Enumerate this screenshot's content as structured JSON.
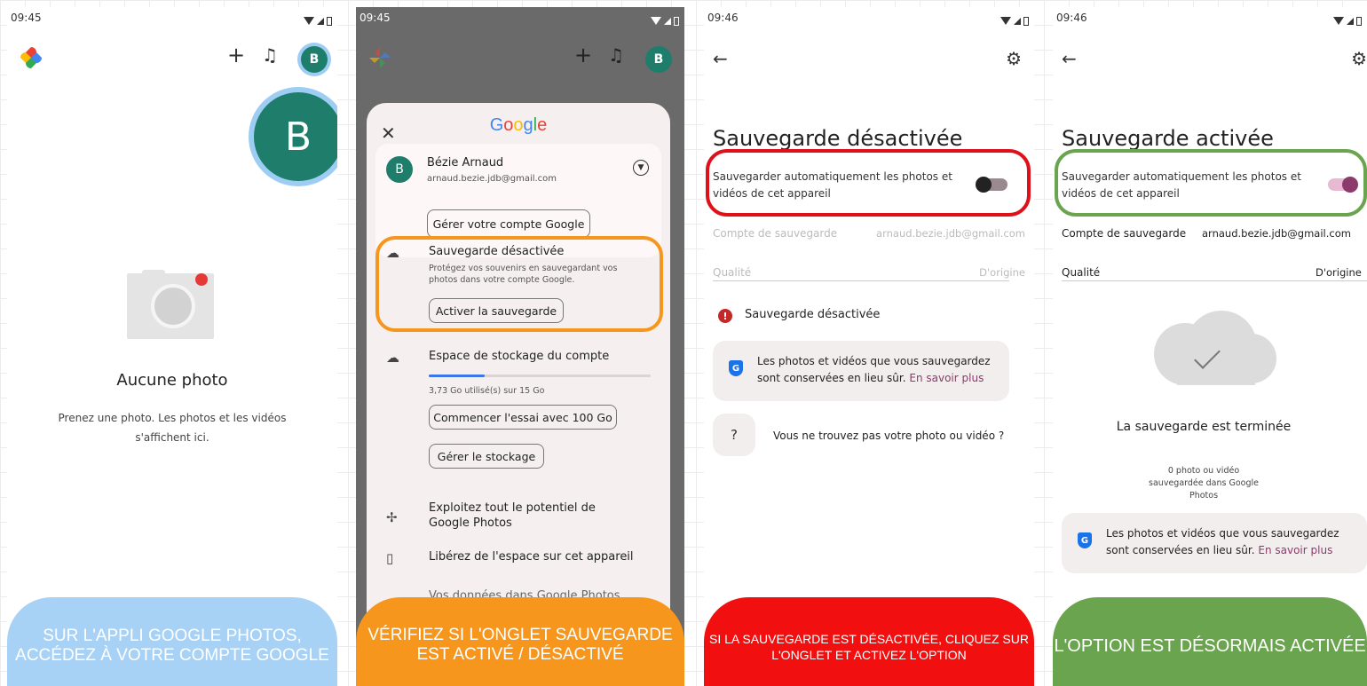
{
  "status": {
    "time1": "09:45",
    "time2": "09:45",
    "time3": "09:46",
    "time4": "09:46"
  },
  "panel1": {
    "avatar_letter": "B",
    "empty_title": "Aucune photo",
    "empty_text": "Prenez une photo. Les photos et les vidéos s'affichent ici.",
    "caption": "SUR L'APPLI GOOGLE PHOTOS, ACCÉDEZ À VOTRE COMPTE GOOGLE"
  },
  "panel2": {
    "google_label": "Google",
    "account_name": "Bézie Arnaud",
    "account_email": "arnaud.bezie.jdb@gmail.com",
    "manage_account": "Gérer votre compte Google",
    "backup_title": "Sauvegarde désactivée",
    "backup_desc": "Protégez vos souvenirs en sauvegardant vos photos dans votre compte Google.",
    "activate_backup": "Activer la sauvegarde",
    "storage_title": "Espace de stockage du compte",
    "storage_fraction": 0.25,
    "storage_used": "3,73 Go utilisé(s) sur 15 Go",
    "trial_button": "Commencer l'essai avec 100 Go",
    "manage_storage": "Gérer le stockage",
    "potential": "Exploitez tout le potentiel de Google Photos",
    "free_space": "Libérez de l'espace sur cet appareil",
    "cut_off_row": "Vos données dans Google Photos",
    "caption": "VÉRIFIEZ SI L'ONGLET SAUVEGARDE EST ACTIVÉ / DÉSACTIVÉ"
  },
  "panel3": {
    "title": "Sauvegarde désactivée",
    "toggle_label": "Sauvegarder automatiquement les photos et vidéos de cet appareil",
    "account_label": "Compte de sauvegarde",
    "account_value": "arnaud.bezie.jdb@gmail.com",
    "quality_label": "Qualité",
    "quality_value": "D'origine",
    "status_label": "Sauvegarde désactivée",
    "info_text": "Les photos et vidéos que vous sauvegardez sont conservées en lieu sûr.",
    "info_link": "En savoir plus",
    "help_text": "Vous ne trouvez pas votre photo ou vidéo ?",
    "caption": "SI LA SAUVEGARDE EST DÉSACTIVÉE, CLIQUEZ SUR L'ONGLET ET ACTIVEZ L'OPTION"
  },
  "panel4": {
    "title": "Sauvegarde activée",
    "toggle_label": "Sauvegarder automatiquement les photos et vidéos de cet appareil",
    "account_label": "Compte de sauvegarde",
    "account_value": "arnaud.bezie.jdb@gmail.com",
    "quality_label": "Qualité",
    "quality_value": "D'origine",
    "done_title": "La sauvegarde est terminée",
    "done_sub": "0 photo ou vidéo sauvegardée dans Google Photos",
    "info_text": "Les photos et vidéos que vous sauvegardez sont conservées en lieu sûr.",
    "info_link": "En savoir plus",
    "caption": "L'OPTION EST DÉSORMAIS ACTIVÉE"
  },
  "colors": {
    "blue_highlight": "#9ecdf3",
    "orange_highlight": "#f7961d",
    "red_highlight": "#e0101a",
    "green_highlight": "#6aa44f",
    "toggle_on": "#8b3a6b"
  }
}
